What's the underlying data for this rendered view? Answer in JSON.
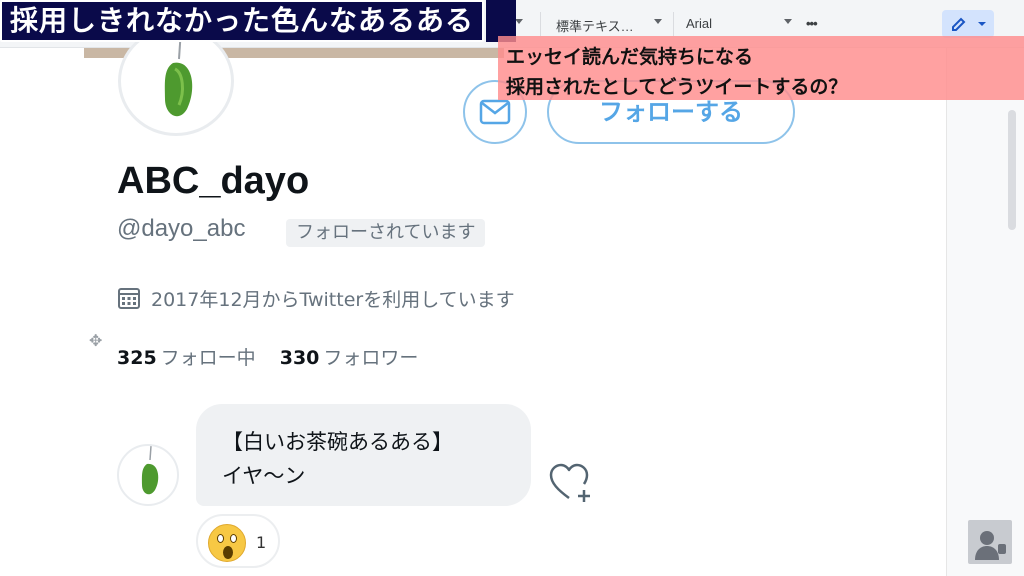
{
  "toolbar": {
    "zoom_suffix": "%",
    "style_select": "標準テキス…",
    "font_select": "Arial",
    "more": "•••"
  },
  "title_overlay": "採用しきれなかった色んなあるある",
  "comment_overlay": {
    "line1": "エッセイ読んだ気持ちになる",
    "line2": "採用されたとしてどうツイートするの？"
  },
  "profile": {
    "display_name": "ABC_dayo",
    "handle": "@dayo_abc",
    "follows_you": "フォローされています",
    "joined": "2017年12月からTwitterを利用しています",
    "following_count": "325",
    "following_label": "フォロー中",
    "followers_count": "330",
    "followers_label": "フォロワー",
    "follow_button": "フォローする"
  },
  "tweet": {
    "line1": "【白いお茶碗あるある】",
    "line2": "イヤ〜ン",
    "reaction_count": "1"
  },
  "icons": {
    "mail": "mail-icon",
    "calendar": "calendar-icon",
    "heart": "heart-add-icon",
    "pencil": "pencil-icon",
    "avatar": "green-leaf-charm"
  },
  "colors": {
    "title_bg": "#0a0a4a",
    "comment_bg": "#ff8c8c",
    "follow_blue": "#55a6e6",
    "muted_text": "#66727d"
  }
}
